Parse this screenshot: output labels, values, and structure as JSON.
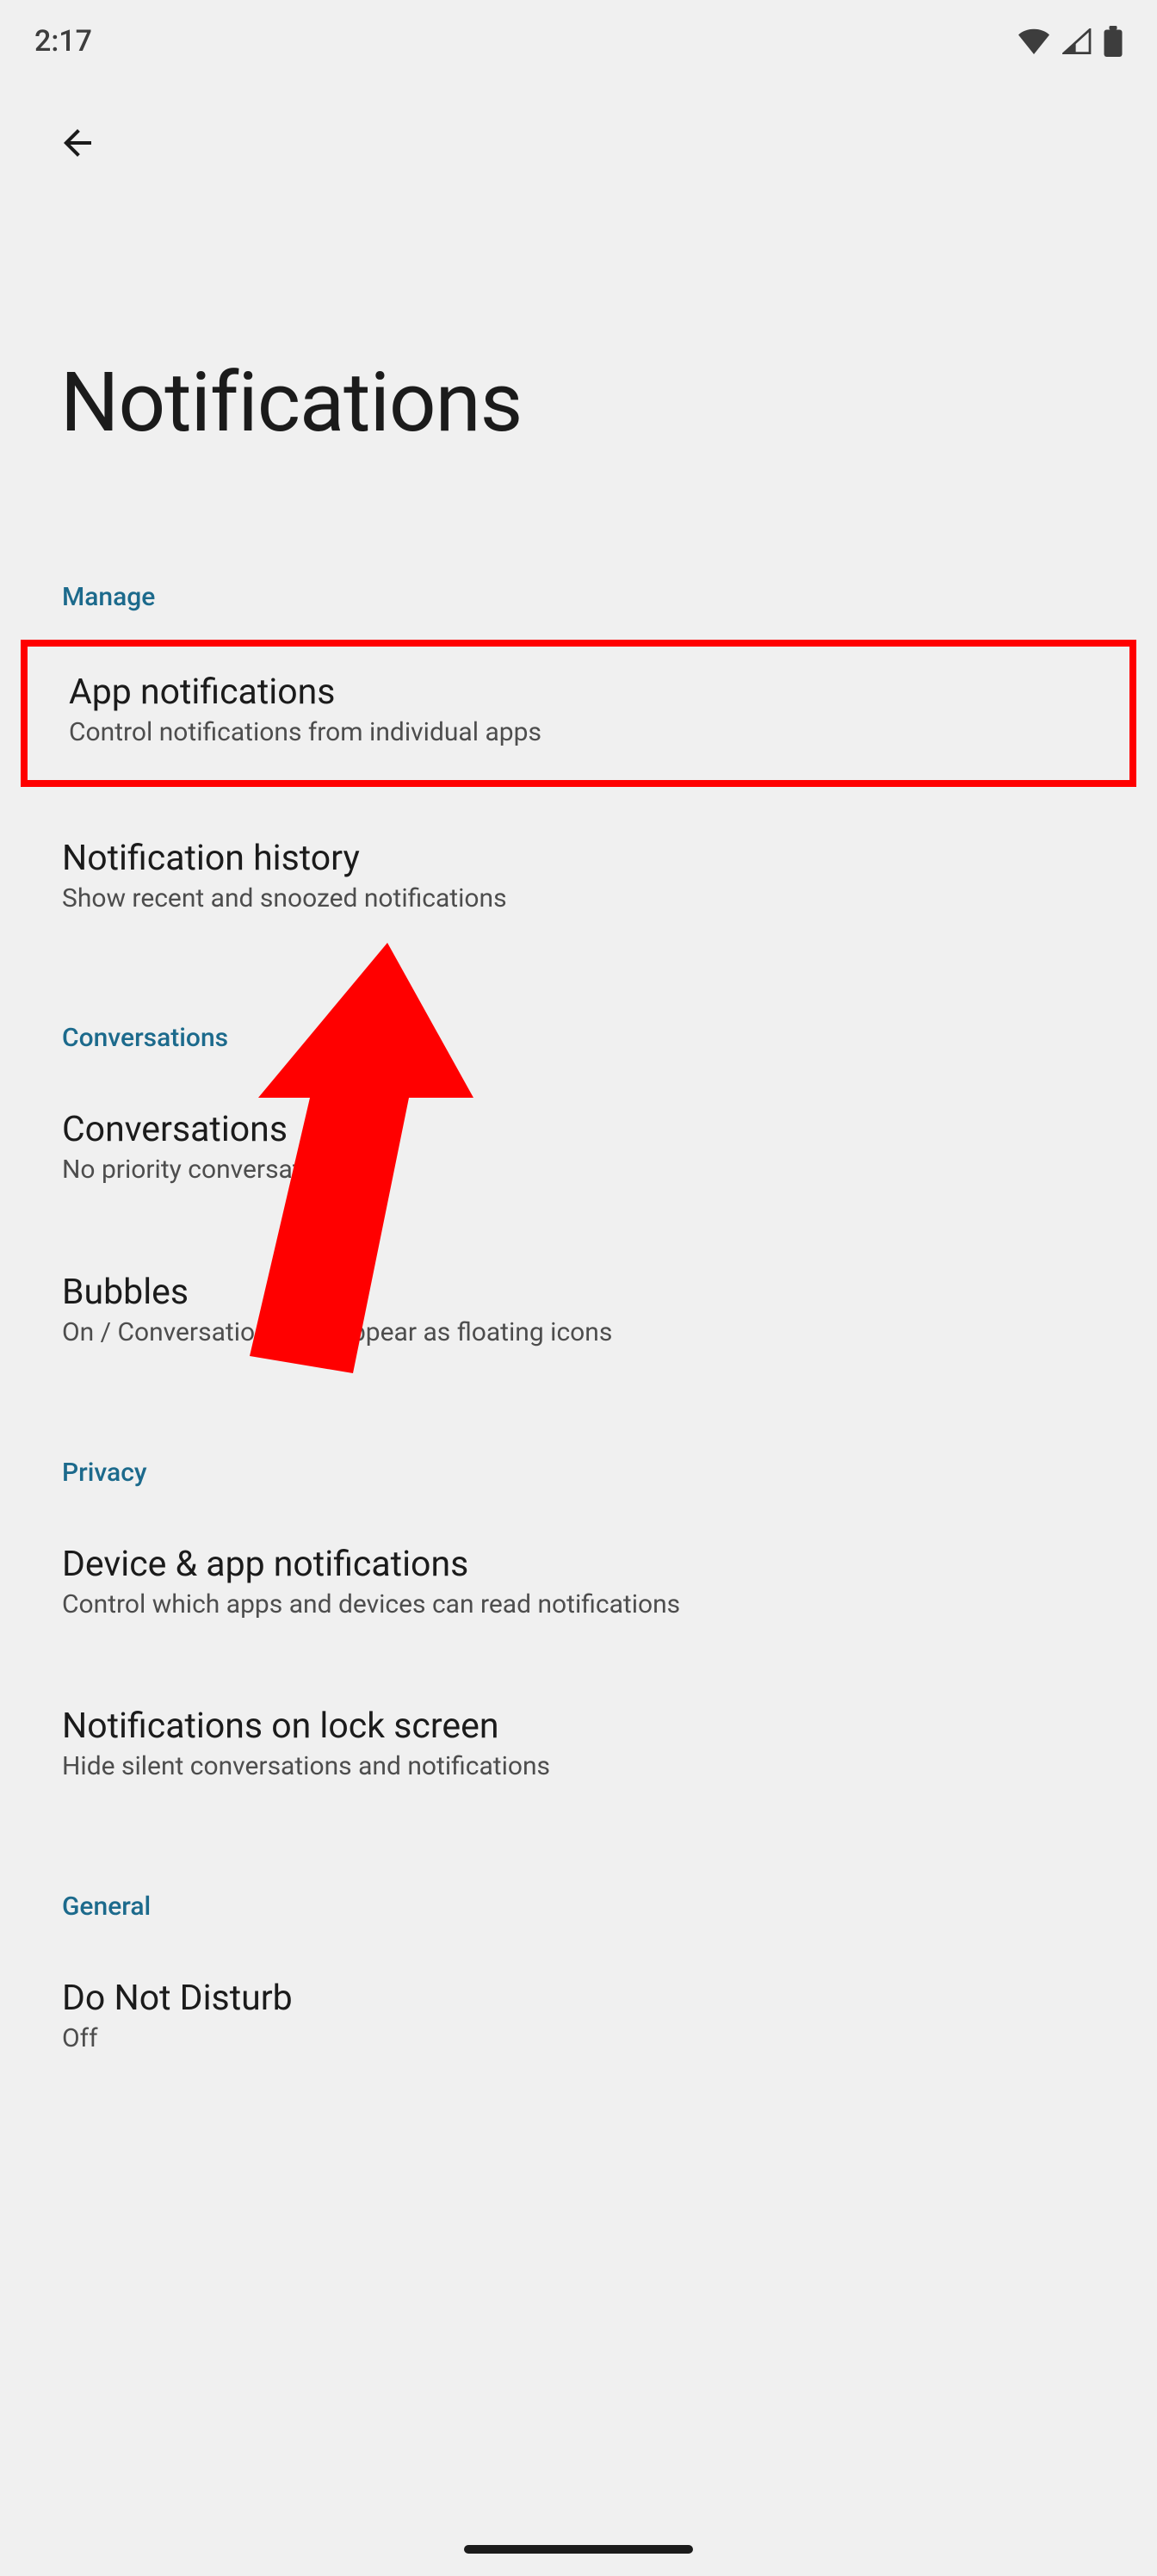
{
  "status": {
    "time": "2:17"
  },
  "page_title": "Notifications",
  "sections": {
    "manage": {
      "header": "Manage",
      "app_notifications": {
        "title": "App notifications",
        "sub": "Control notifications from individual apps"
      },
      "notification_history": {
        "title": "Notification history",
        "sub": "Show recent and snoozed notifications"
      }
    },
    "conversations": {
      "header": "Conversations",
      "conversations": {
        "title": "Conversations",
        "sub": "No priority conversations"
      },
      "bubbles": {
        "title": "Bubbles",
        "sub": "On / Conversations can appear as floating icons"
      }
    },
    "privacy": {
      "header": "Privacy",
      "device_app": {
        "title": "Device & app notifications",
        "sub": "Control which apps and devices can read notifications"
      },
      "lock_screen": {
        "title": "Notifications on lock screen",
        "sub": "Hide silent conversations and notifications"
      }
    },
    "general": {
      "header": "General",
      "dnd": {
        "title": "Do Not Disturb",
        "sub": "Off"
      }
    }
  }
}
